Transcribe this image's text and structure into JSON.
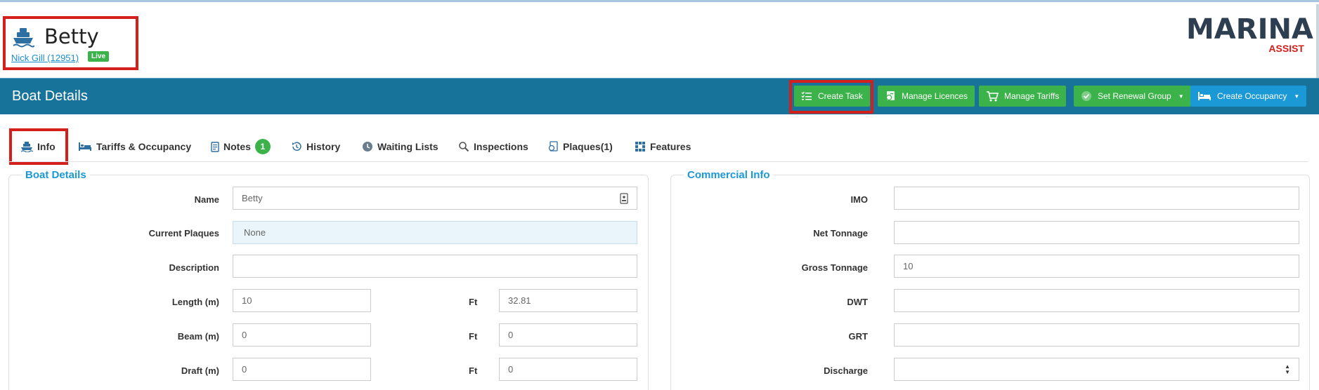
{
  "header": {
    "boat_name": "Betty",
    "owner_link": "Nick Gill (12951)",
    "status_badge": "Live",
    "logo_main": "MARINA",
    "logo_sub": "ASSIST"
  },
  "toolbar": {
    "title": "Boat Details",
    "buttons": {
      "create_task": "Create Task",
      "manage_licences": "Manage Licences",
      "manage_tariffs": "Manage Tariffs",
      "set_renewal_group": "Set Renewal Group",
      "create_occupancy": "Create Occupancy"
    }
  },
  "tabs": {
    "info": "Info",
    "tariffs_occupancy": "Tariffs & Occupancy",
    "notes": "Notes",
    "notes_count": "1",
    "history": "History",
    "waiting_lists": "Waiting Lists",
    "inspections": "Inspections",
    "plaques": "Plaques(1)",
    "features": "Features"
  },
  "boat_details": {
    "title": "Boat Details",
    "name_label": "Name",
    "name_value": "Betty",
    "plaques_label": "Current Plaques",
    "plaques_value": "None",
    "description_label": "Description",
    "description_value": "",
    "length_label": "Length (m)",
    "length_value": "10",
    "length_ft_label": "Ft",
    "length_ft_value": "32.81",
    "beam_label": "Beam (m)",
    "beam_value": "0",
    "beam_ft_label": "Ft",
    "beam_ft_value": "0",
    "draft_label": "Draft (m)",
    "draft_value": "0",
    "draft_ft_label": "Ft",
    "draft_ft_value": "0"
  },
  "commercial_info": {
    "title": "Commercial Info",
    "imo_label": "IMO",
    "imo_value": "",
    "net_tonnage_label": "Net Tonnage",
    "net_tonnage_value": "",
    "gross_tonnage_label": "Gross Tonnage",
    "gross_tonnage_value": "10",
    "dwt_label": "DWT",
    "dwt_value": "",
    "grt_label": "GRT",
    "grt_value": "",
    "discharge_label": "Discharge",
    "discharge_value": ""
  },
  "icons": {
    "boat": "boat-icon",
    "task": "task-list-icon",
    "licence": "licence-icon",
    "cart": "cart-icon",
    "check": "check-circle-icon",
    "bed": "bed-icon",
    "notes": "notes-icon",
    "history": "history-icon",
    "clock": "clock-icon",
    "search": "search-icon",
    "plaque": "plaque-icon",
    "grid": "grid-icon"
  },
  "colors": {
    "toolbar_bg": "#17739a",
    "green_button": "#3cb34a",
    "blue_button": "#1b98d6",
    "highlight": "#d3201d",
    "panel_title": "#1b98d6"
  }
}
